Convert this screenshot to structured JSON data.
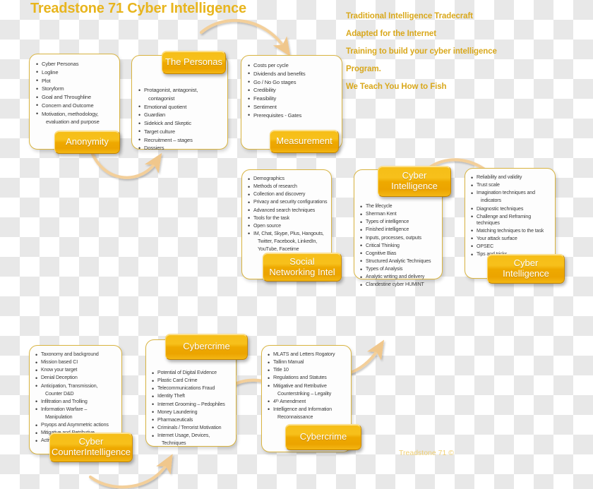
{
  "title": "Treadstone 71 Cyber Intelligence",
  "copyright": "Treadstone 71 ©",
  "notes": [
    "Traditional Intelligence Tradecraft",
    "Adapted for the Internet",
    "Training to build your cyber intelligence",
    "Program.",
    "We Teach You How to Fish"
  ],
  "colors": {
    "gold_light": "#f6be17",
    "gold_dark": "#eca400",
    "panel_border": "#d9b441",
    "title_text": "#e8b51e",
    "note_text": "#d9a81c",
    "body_text": "#3a3a3a",
    "arrow": "#f3cf9a"
  },
  "nodes": [
    {
      "id": "anonymity",
      "label": "Anonymity",
      "items": [
        "Cyber Personas",
        "Logline",
        "Plot",
        "Storyform",
        "Goal and Throughline",
        "Concern and Outcome",
        "Motivation, methodology,",
        "evaluation and purpose"
      ]
    },
    {
      "id": "the-personas",
      "label": "The Personas",
      "items": [
        "Protagonist, antagonist,",
        "contagonist",
        "Emotional quotient",
        "Guardian",
        "Sidekick and Skeptic",
        "Target culture",
        "Recruitment – stages",
        "Dossiers"
      ]
    },
    {
      "id": "measurement",
      "label": "Measurement",
      "items": [
        "Costs per cycle",
        "Dividends and benefits",
        "Go / No Go stages",
        "Credibility",
        "Feasibility",
        "Sentiment",
        "Prerequisites - Gates"
      ]
    },
    {
      "id": "social-networking-intel",
      "label": "Social\nNetworking Intel",
      "label_line1": "Social",
      "label_line2": "Networking Intel",
      "items": [
        "Demographics",
        "Methods of research",
        "Collection and discovery",
        "Privacy and security configurations",
        "Advanced search techniques",
        "Tools for the task",
        "Open source",
        "IM, Chat, Skype, Plus, Hangouts,",
        "Twitter, Facebook, LinkedIn,",
        "YouTube, Facetime"
      ]
    },
    {
      "id": "cyber-intelligence-center",
      "label_line1": "Cyber",
      "label_line2": "Intelligence",
      "items": [
        "The lifecycle",
        "Sherman Kent",
        "Types of intelligence",
        "Finished intelligence",
        "Inputs, processes, outputs",
        "Critical Thinking",
        "Cognitive Bias",
        "Structured Analytic Techniques",
        "Types of Analysis",
        "Analytic writing and delivery",
        "Clandestine cyber HUMINT"
      ]
    },
    {
      "id": "cyber-intelligence-right",
      "label_line1": "Cyber",
      "label_line2": "Intelligence",
      "items": [
        "Reliability and validity",
        "Trust scale",
        "Imagination techniques and",
        "indicators",
        "Diagnostic techniques",
        "Challenge and Reframing techniques",
        "Matching techniques to the task",
        "Your attack surface",
        "OPSEC",
        "Tips and tricks"
      ]
    },
    {
      "id": "cyber-counterintelligence",
      "label_line1": "Cyber",
      "label_line2": "CounterIntelligence",
      "items": [
        "Taxonomy and background",
        "Mission based CI",
        "Know your target",
        "Denial Deception",
        "Anticipation, Transmission,",
        "Counter D&D",
        "Infiltration and Trolling",
        "Information Warfare –",
        "Manipulation",
        "Psyops and Asymmetric actions",
        "Mitigative and Retributive",
        "Active Defense"
      ]
    },
    {
      "id": "cybercrime-left",
      "label": "Cybercrime",
      "items": [
        "Potential of Digital Evidence",
        "Plastic Card Crime",
        "Telecommunications Fraud",
        "Identity Theft",
        "Internet Grooming – Pedophiles",
        "Money Laundering",
        "Pharmaceuticals",
        "Criminals / Terrorist Motivation",
        "Internet Usage, Devices,",
        "Techniques"
      ]
    },
    {
      "id": "cybercrime-right",
      "label": "Cybercrime",
      "items": [
        "MLATS and Letters Rogatory",
        "Tallinn Manual",
        "Title 10",
        "Regulations and Statutes",
        "Mitigative and Retributive",
        "Counterstriking – Legality",
        "4ᵗʰ Amendment",
        "Intelligence and Information",
        "Reconnaissance"
      ]
    }
  ]
}
